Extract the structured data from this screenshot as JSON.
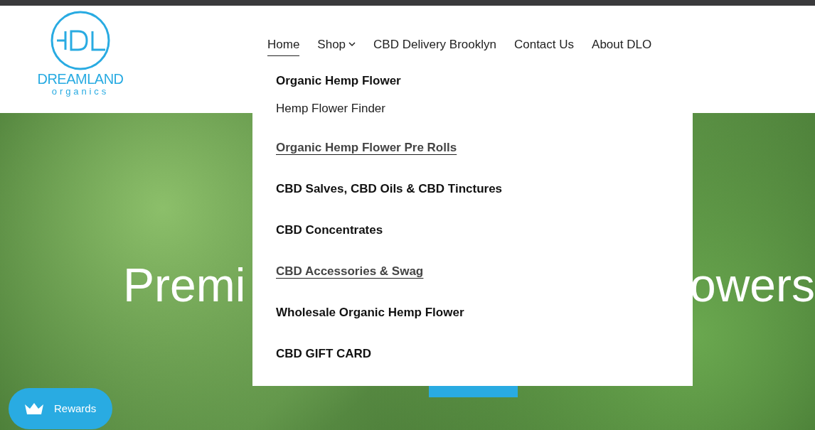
{
  "logo": {
    "name": "DREAMLAND",
    "tagline": "organics"
  },
  "nav": [
    {
      "label": "Home",
      "selected": true,
      "dropdown": false
    },
    {
      "label": "Shop",
      "selected": false,
      "dropdown": true
    },
    {
      "label": "CBD Delivery Brooklyn",
      "selected": false,
      "dropdown": false
    },
    {
      "label": "Contact Us",
      "selected": false,
      "dropdown": false
    },
    {
      "label": "About DLO",
      "selected": false,
      "dropdown": false
    }
  ],
  "shop_menu": [
    {
      "label": "Organic Hemp Flower",
      "kind": "bold"
    },
    {
      "label": "Hemp Flower Finder",
      "kind": "plain"
    },
    {
      "label": "Organic Hemp Flower Pre Rolls",
      "kind": "underlined"
    },
    {
      "label": "CBD Salves, CBD Oils & CBD Tinctures",
      "kind": "bold"
    },
    {
      "label": "CBD Concentrates",
      "kind": "bold"
    },
    {
      "label": "CBD Accessories & Swag",
      "kind": "underlined"
    },
    {
      "label": "Wholesale Organic Hemp Flower",
      "kind": "bold"
    },
    {
      "label": "CBD GIFT CARD",
      "kind": "bold"
    }
  ],
  "hero": {
    "heading_left": "Premi",
    "heading_right": "owers"
  },
  "rewards": {
    "label": "Rewards"
  }
}
